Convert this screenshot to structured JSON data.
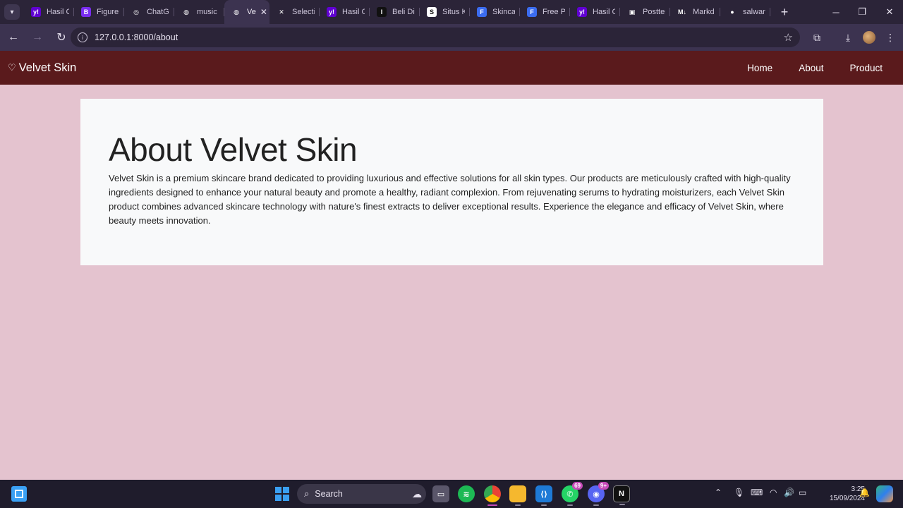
{
  "browser": {
    "tabs": [
      {
        "label": "Hasil C",
        "icon": "yahoo-icon",
        "color": "#6001d2",
        "glyph": "y!"
      },
      {
        "label": "Figures",
        "icon": "bootstrap-icon",
        "color": "#7a2df0",
        "glyph": "B"
      },
      {
        "label": "ChatG",
        "icon": "chatgpt-icon",
        "color": "#2b2438",
        "glyph": "◎"
      },
      {
        "label": "music",
        "icon": "globe-icon",
        "color": "#2b2438",
        "glyph": "◍"
      },
      {
        "label": "Ve",
        "icon": "globe-icon",
        "color": "#3c3350",
        "glyph": "◍",
        "active": true
      },
      {
        "label": "Selecti",
        "icon": "zoho-icon",
        "color": "#2b2438",
        "glyph": "✕"
      },
      {
        "label": "Hasil C",
        "icon": "yahoo-icon",
        "color": "#6001d2",
        "glyph": "y!"
      },
      {
        "label": "Beli Di",
        "icon": "tokopedia-icon",
        "color": "#111111",
        "glyph": "I"
      },
      {
        "label": "Situs K",
        "icon": "scribd-icon",
        "color": "#ffffff",
        "glyph": "S"
      },
      {
        "label": "Skincar",
        "icon": "form-icon",
        "color": "#3b6cf0",
        "glyph": "F"
      },
      {
        "label": "Free Pl",
        "icon": "form-icon",
        "color": "#3b6cf0",
        "glyph": "F"
      },
      {
        "label": "Hasil C",
        "icon": "yahoo-icon",
        "color": "#6001d2",
        "glyph": "y!"
      },
      {
        "label": "Posttes",
        "icon": "image-icon",
        "color": "#2b2438",
        "glyph": "▣"
      },
      {
        "label": "Markd",
        "icon": "markdown-icon",
        "color": "#2b2438",
        "glyph": "M↓"
      },
      {
        "label": "salwarl",
        "icon": "github-icon",
        "color": "#2b2438",
        "glyph": "●"
      }
    ],
    "close_tab": "✕",
    "new_tab": "+",
    "url": "127.0.0.1:8000/about"
  },
  "site": {
    "brand": "Velvet Skin",
    "brand_icon": "heart-icon",
    "nav": [
      "Home",
      "About",
      "Product"
    ],
    "colors": {
      "navbar": "#5a1a1c",
      "page_bg": "#e4c3cf",
      "card_bg": "#f8f9fa"
    }
  },
  "about": {
    "title": "About Velvet Skin",
    "body": "Velvet Skin is a premium skincare brand dedicated to providing luxurious and effective solutions for all skin types. Our products are meticulously crafted with high-quality ingredients designed to enhance your natural beauty and promote a healthy, radiant complexion. From rejuvenating serums to hydrating moisturizers, each Velvet Skin product combines advanced skincare technology with nature's finest extracts to deliver exceptional results. Experience the elegance and efficacy of Velvet Skin, where beauty meets innovation."
  },
  "taskbar": {
    "search_label": "Search",
    "whatsapp_badge": "69",
    "discord_badge": "9+",
    "time": "3:25",
    "date": "15/09/2024"
  }
}
